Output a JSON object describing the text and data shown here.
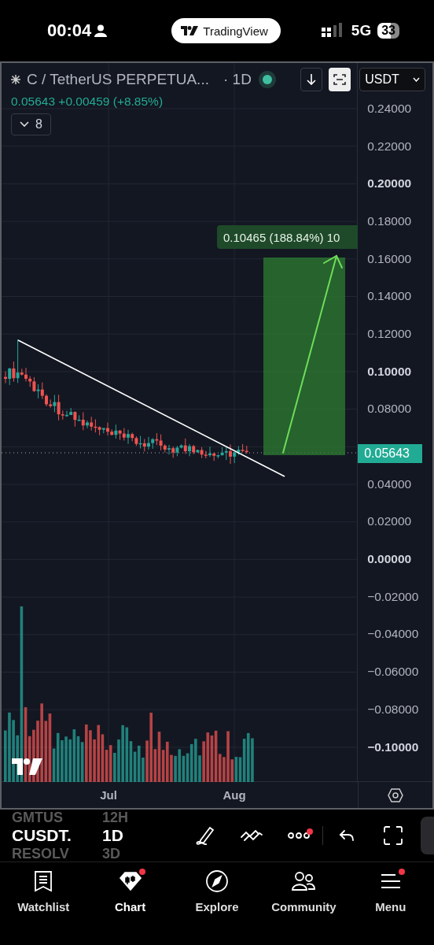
{
  "status_bar": {
    "time": "00:04",
    "app_pill": "TradingView",
    "network": "5G",
    "battery": "33"
  },
  "chart": {
    "symbol_title": "C / TetherUS PERPETUA...",
    "interval": "· 1D",
    "quote": "0.05643 +0.00459 (+8.85%)",
    "indicators_count": "8",
    "currency": "USDT",
    "price_axis_above": [
      {
        "label": "0.24000",
        "major": false
      },
      {
        "label": "0.22000",
        "major": false
      },
      {
        "label": "0.20000",
        "major": true
      },
      {
        "label": "0.18000",
        "major": false
      },
      {
        "label": "0.16000",
        "major": false
      },
      {
        "label": "0.14000",
        "major": false
      },
      {
        "label": "0.12000",
        "major": false
      },
      {
        "label": "0.10000",
        "major": true
      },
      {
        "label": "0.08000",
        "major": false
      }
    ],
    "current_price": "0.05643",
    "price_axis_below": [
      {
        "label": "0.04000",
        "major": false
      },
      {
        "label": "0.02000",
        "major": false
      },
      {
        "label": "0.00000",
        "major": true
      },
      {
        "label": "−0.02000",
        "major": false
      },
      {
        "label": "−0.04000",
        "major": false
      },
      {
        "label": "−0.06000",
        "major": false
      },
      {
        "label": "−0.08000",
        "major": false
      },
      {
        "label": "−0.10000",
        "major": true
      }
    ],
    "projection_label": "0.10465 (188.84%) 10",
    "time_axis": [
      "Jul",
      "Aug"
    ]
  },
  "toolbar": {
    "prev": {
      "symbol": "GMTUS",
      "interval": "12H"
    },
    "current": {
      "symbol": "CUSDT.",
      "interval": "1D"
    },
    "next": {
      "symbol": "RESOLV",
      "interval": "3D"
    },
    "tools": [
      {
        "kind": "draw",
        "alert": false
      },
      {
        "kind": "lines",
        "alert": false
      },
      {
        "kind": "more",
        "alert": true
      },
      {
        "kind": "undo",
        "alert": false
      },
      {
        "kind": "fullscreen",
        "alert": false
      }
    ]
  },
  "nav": [
    {
      "label": "Watchlist",
      "kind": "watchlist",
      "selected": false,
      "alert": false
    },
    {
      "label": "Chart",
      "kind": "chart",
      "selected": true,
      "alert": true
    },
    {
      "label": "Explore",
      "kind": "explore",
      "selected": false,
      "alert": false
    },
    {
      "label": "Community",
      "kind": "community",
      "selected": false,
      "alert": false
    },
    {
      "label": "Menu",
      "kind": "menu",
      "selected": false,
      "alert": true
    }
  ]
}
